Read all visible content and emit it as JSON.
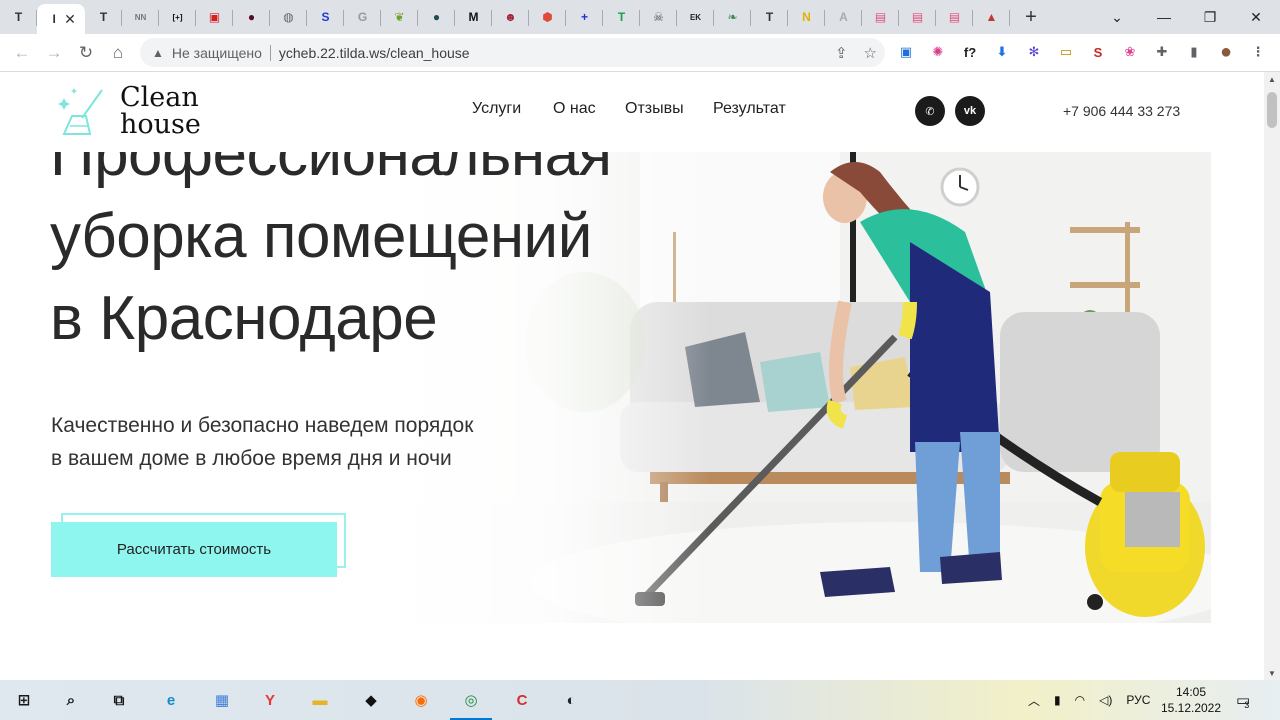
{
  "browser": {
    "tabs": [
      {
        "icon": "tilda-icon",
        "glyph": "T",
        "color": "#333333"
      },
      {
        "icon": "active-tab-icon",
        "glyph": "I",
        "color": "#333333",
        "active": true
      },
      {
        "icon": "tilda-icon",
        "glyph": "T",
        "color": "#333333"
      },
      {
        "icon": "nm-icon",
        "glyph": "NN",
        "color": "#777777"
      },
      {
        "icon": "code-icon",
        "glyph": "[+]",
        "color": "#111111"
      },
      {
        "icon": "red-badge-icon",
        "glyph": "▣",
        "color": "#d32020"
      },
      {
        "icon": "dark-circle-icon",
        "glyph": "●",
        "color": "#5a0b22"
      },
      {
        "icon": "globe-icon",
        "glyph": "◍",
        "color": "#666666"
      },
      {
        "icon": "s-blue-icon",
        "glyph": "S",
        "color": "#1a3fd6"
      },
      {
        "icon": "g-icon",
        "glyph": "G",
        "color": "#999999"
      },
      {
        "icon": "leaf-icon",
        "glyph": "❦",
        "color": "#6ca12a"
      },
      {
        "icon": "teal-circle-icon",
        "glyph": "●",
        "color": "#1d4f52"
      },
      {
        "icon": "m-logo-icon",
        "glyph": "M",
        "color": "#111111"
      },
      {
        "icon": "face-icon",
        "glyph": "☻",
        "color": "#a0243a"
      },
      {
        "icon": "red-hex-icon",
        "glyph": "⬢",
        "color": "#e14a3b"
      },
      {
        "icon": "blue-plus-icon",
        "glyph": "+",
        "color": "#2233cc"
      },
      {
        "icon": "t-green-icon",
        "glyph": "T",
        "color": "#16a34a"
      },
      {
        "icon": "skull-icon",
        "glyph": "☠",
        "color": "#555555"
      },
      {
        "icon": "ek-icon",
        "glyph": "EK",
        "color": "#222222"
      },
      {
        "icon": "plant-icon",
        "glyph": "❧",
        "color": "#3d8a52"
      },
      {
        "icon": "tilda-icon",
        "glyph": "T",
        "color": "#333333"
      },
      {
        "icon": "n-yellow-icon",
        "glyph": "N",
        "color": "#e3b100"
      },
      {
        "icon": "a-circle-icon",
        "glyph": "A",
        "color": "#aaaaaa"
      },
      {
        "icon": "pink-window-icon",
        "glyph": "▤",
        "color": "#e0517a"
      },
      {
        "icon": "pink-window-icon",
        "glyph": "▤",
        "color": "#e0517a"
      },
      {
        "icon": "pink-window-icon",
        "glyph": "▤",
        "color": "#e0517a"
      },
      {
        "icon": "fire-icon",
        "glyph": "▲",
        "color": "#c0392b"
      }
    ],
    "new_tab": "+",
    "window": {
      "minimize": "—",
      "restore": "❐",
      "close": "✕"
    },
    "address": {
      "security_label": "Не защищено",
      "url": "ycheb.22.tilda.ws/clean_house"
    },
    "extensions": [
      {
        "icon": "blue-square-icon",
        "glyph": "▣",
        "color": "#1e6fd9"
      },
      {
        "icon": "color-wheel-icon",
        "glyph": "✺",
        "color": "#d93a8c"
      },
      {
        "icon": "function-icon",
        "glyph": "f?",
        "color": "#222222"
      },
      {
        "icon": "download-icon",
        "glyph": "⬇",
        "color": "#1a73e8"
      },
      {
        "icon": "snowflake-icon",
        "glyph": "✻",
        "color": "#5b3fd6"
      },
      {
        "icon": "folder-n-icon",
        "glyph": "▭",
        "color": "#b58a00"
      },
      {
        "icon": "s-red-icon",
        "glyph": "S",
        "color": "#c62828"
      },
      {
        "icon": "flower-icon",
        "glyph": "❀",
        "color": "#e0408b"
      },
      {
        "icon": "puzzle-icon",
        "glyph": "✚",
        "color": "#5f6368"
      },
      {
        "icon": "sidepanel-icon",
        "glyph": "▮",
        "color": "#5f6368"
      },
      {
        "icon": "profile-avatar-icon",
        "glyph": "●",
        "color": "#8a5a3c"
      },
      {
        "icon": "menu-dots-icon",
        "glyph": "⋮",
        "color": "#5f6368"
      }
    ]
  },
  "site": {
    "logo": {
      "line1": "Clean",
      "line2": "house"
    },
    "nav": [
      "Услуги",
      "О нас",
      "Отзывы",
      "Результат"
    ],
    "phone": "+7 906 444 33 273",
    "hero": {
      "title_line1": "Профессиональная",
      "title_line2": "уборка помещений",
      "title_line3": "в Краснодаре",
      "subtitle_line1": "Качественно и безопасно наведем порядок",
      "subtitle_line2": "в вашем доме в любое время дня и ночи",
      "cta": "Рассчитать стоимость"
    },
    "accent_color": "#8ef6ee"
  },
  "taskbar": {
    "apps": [
      {
        "icon": "windows-start-icon",
        "glyph": "⊞",
        "color": "#1a1a1a"
      },
      {
        "icon": "search-icon",
        "glyph": "⌕",
        "color": "#1a1a1a"
      },
      {
        "icon": "task-view-icon",
        "glyph": "⧉",
        "color": "#1a1a1a"
      },
      {
        "icon": "edge-icon",
        "glyph": "e",
        "color": "#1b8ac9"
      },
      {
        "icon": "calculator-icon",
        "glyph": "▦",
        "color": "#3d7dd8"
      },
      {
        "icon": "yandex-icon",
        "glyph": "Y",
        "color": "#e53935"
      },
      {
        "icon": "file-explorer-icon",
        "glyph": "▬",
        "color": "#e8b423"
      },
      {
        "icon": "figma-icon",
        "glyph": "◆",
        "color": "#111111"
      },
      {
        "icon": "firefox-icon",
        "glyph": "◉",
        "color": "#ff6a00"
      },
      {
        "icon": "chrome-icon",
        "glyph": "◎",
        "color": "#1e8e3e"
      },
      {
        "icon": "ccleaner-icon",
        "glyph": "C",
        "color": "#d32f2f"
      },
      {
        "icon": "obs-icon",
        "glyph": "◐",
        "color": "#222222"
      }
    ],
    "tray": {
      "language": "РУС",
      "time": "14:05",
      "date": "15.12.2022",
      "notifications": "3"
    }
  }
}
